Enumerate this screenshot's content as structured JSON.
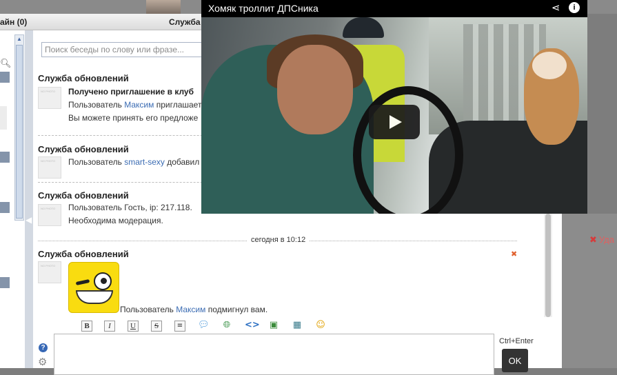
{
  "window": {
    "online_label": "айн (0)",
    "title": "Служба"
  },
  "search": {
    "placeholder": "Поиск беседы по слову или фразе..."
  },
  "messages": [
    {
      "sender": "Служба обновлений",
      "lines": [
        "Получено приглашение в клуб",
        "Пользователь",
        "Максим",
        "приглашает",
        "Вы можете принять его предложе"
      ]
    },
    {
      "sender": "Служба обновлений",
      "prefix": "Пользователь",
      "user": "smart-sexy",
      "action": "добавил"
    },
    {
      "sender": "Служба обновлений",
      "line1": "Пользователь  Гость, ip:  217.118.",
      "line2": "Необходима модерация."
    }
  ],
  "date_separator": "сегодня в 10:12",
  "wink_message": {
    "sender": "Служба обновлений",
    "prefix": "Пользователь",
    "user": "Максим",
    "action": "подмигнул вам."
  },
  "toolbar": {
    "bold": "B",
    "italic": "I",
    "underline": "U",
    "strike": "S"
  },
  "compose": {
    "hint": "Ctrl+Enter",
    "ok": "OK"
  },
  "video": {
    "title": "Хомяк троллит ДПСника"
  },
  "side": {
    "delete": "Уда"
  },
  "colors": {
    "link": "#3b6cb3",
    "accent_divider": "#d3d9e2"
  }
}
